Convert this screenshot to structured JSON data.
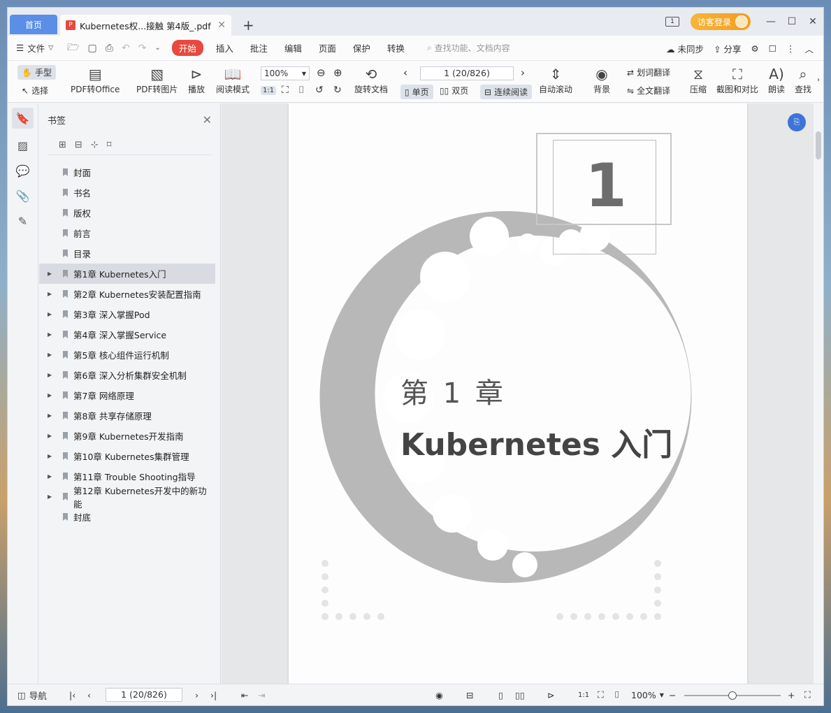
{
  "titlebar": {
    "home_tab": "首页",
    "doc_tab_title": "Kubernetes权...接触 第4版_.pdf",
    "page_indicator": "1",
    "login_label": "访客登录"
  },
  "menubar": {
    "file_label": "文件",
    "items": [
      "开始",
      "插入",
      "批注",
      "编辑",
      "页面",
      "保护",
      "转换"
    ],
    "active_item": "开始",
    "search_placeholder": "查找功能、文档内容",
    "sync_label": "未同步",
    "share_label": "分享"
  },
  "toolbar": {
    "hand_label": "手型",
    "select_label": "选择",
    "pdf_to_office": "PDF转Office",
    "pdf_to_image": "PDF转图片",
    "play": "播放",
    "read_mode": "阅读模式",
    "zoom": "100%",
    "rotate_doc": "旋转文档",
    "page_value": "1 (20/826)",
    "single_page": "单页",
    "double_page": "双页",
    "continuous": "连续阅读",
    "auto_scroll": "自动滚动",
    "background": "背景",
    "word_translate": "划词翻译",
    "full_translate": "全文翻译",
    "compress": "压缩",
    "screenshot_compare": "截图和对比",
    "read_aloud": "朗读",
    "find": "查找"
  },
  "bookmarks": {
    "title": "书签",
    "items": [
      {
        "label": "封面",
        "expandable": false
      },
      {
        "label": "书名",
        "expandable": false
      },
      {
        "label": "版权",
        "expandable": false
      },
      {
        "label": "前言",
        "expandable": false
      },
      {
        "label": "目录",
        "expandable": false
      },
      {
        "label": "第1章 Kubernetes入门",
        "expandable": true
      },
      {
        "label": "第2章 Kubernetes安装配置指南",
        "expandable": true
      },
      {
        "label": "第3章 深入掌握Pod",
        "expandable": true
      },
      {
        "label": "第4章 深入掌握Service",
        "expandable": true
      },
      {
        "label": "第5章 核心组件运行机制",
        "expandable": true
      },
      {
        "label": "第6章 深入分析集群安全机制",
        "expandable": true
      },
      {
        "label": "第7章 网络原理",
        "expandable": true
      },
      {
        "label": "第8章 共享存储原理",
        "expandable": true
      },
      {
        "label": "第9章 Kubernetes开发指南",
        "expandable": true
      },
      {
        "label": "第10章 Kubernetes集群管理",
        "expandable": true
      },
      {
        "label": "第11章 Trouble Shooting指导",
        "expandable": true
      },
      {
        "label": "第12章 Kubernetes开发中的新功能",
        "expandable": true
      },
      {
        "label": "封底",
        "expandable": false
      }
    ],
    "selected_index": 5
  },
  "page_content": {
    "chapter_number": "1",
    "chapter_label": "第 1 章",
    "chapter_title": "Kubernetes 入门"
  },
  "statusbar": {
    "nav_label": "导航",
    "page_value": "1 (20/826)",
    "zoom": "100%",
    "zoom_level": 0.5
  },
  "colors": {
    "accent_red": "#e8493f",
    "home_tab_blue": "#5b8ee6",
    "login_orange": "#f29d1c"
  }
}
